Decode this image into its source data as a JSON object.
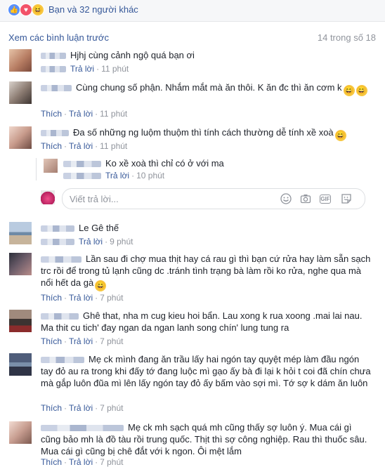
{
  "reactions": {
    "summary": "Bạn và 32 người khác",
    "icons": [
      "like-icon",
      "love-icon",
      "haha-icon"
    ]
  },
  "comments_header": {
    "view_previous": "Xem các bình luận trước",
    "count": "14 trong số 18"
  },
  "labels": {
    "like": "Thích",
    "reply": "Trả lời"
  },
  "composer": {
    "placeholder": "Viết trả lời..."
  },
  "comments": [
    {
      "text": "Hjhj cùng cảnh ngộ quá bạn ơi",
      "time": "11 phút"
    },
    {
      "text": "Cùng chung số phận. Nhắm mắt mà ăn thôi. K ăn đc thì ăn cơm k",
      "time": "11 phút"
    },
    {
      "text": "Đa số những ng luộm thuộm thì tính cách thường dễ tính xề xoà",
      "time": "11 phút"
    },
    {
      "text": "Ko xề xoà thì chỉ có ở với ma",
      "time": "10 phút"
    },
    {
      "text": "Le Gê thế",
      "time": "9 phút"
    },
    {
      "text": "Lần sau đi chợ mua thịt hay cá rau gì thì bạn cứ rửa hay làm sẵn sạch trc rồi để trong tủ lạnh cũng dc .tránh tình trạng bà làm rồi ko rửa, nghe qua mà nổi hết da gà",
      "time": "7 phút"
    },
    {
      "text": "Ghê that, nha m cug kieu hoi bẩn. Lau xong k rua xoong .mai lai nau. Ma thit cu tich' đay ngan da ngan lanh song chín' lung tung ra",
      "time": "7 phút"
    },
    {
      "text": "Mẹ ck mình đang ăn trầu lấy hai ngón tay quyệt mép làm đầu ngón tay đỏ au ra trong khi đấy tớ đang luộc mì gạo ấy bà đi lại k hỏi t coi đã chín chưa mà gắp luôn đũa mì lên lấy ngón tay đỏ ấy bấm vào sợi mì. Tớ sợ k dám ăn luôn",
      "time": "7 phút"
    },
    {
      "text": "Mẹ ck mh sạch quá mh cũng thấy sợ luôn ý. Mua cái gì cũng bảo mh là đồ tàu rồi trung quốc. Thịt thì sợ công nghiệp. Rau thì thuốc sâu. Mua cái gì cũng bị chê đắt với k ngon. Ôi mệt lắm",
      "time": "7 phút"
    }
  ],
  "colors": {
    "link": "#365899",
    "text": "#1d2129",
    "muted": "#90949c",
    "header_bg": "#f6f7f9",
    "like_blue": "#5890ff",
    "love_red": "#f25268",
    "haha_yellow": "#f7c740"
  }
}
